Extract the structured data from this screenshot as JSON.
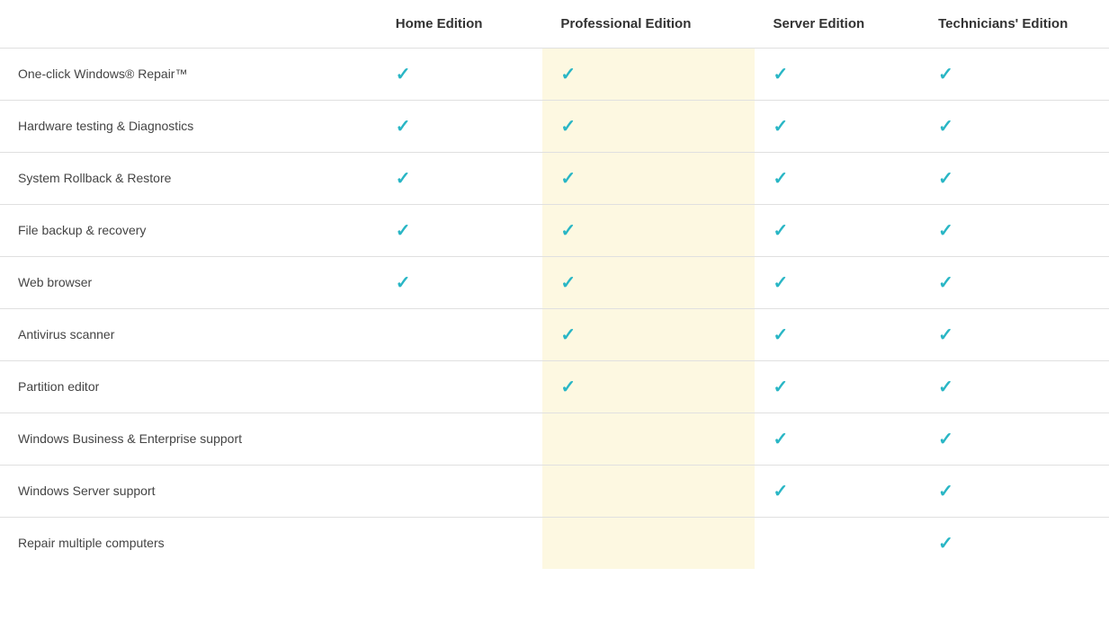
{
  "table": {
    "columns": {
      "feature": "",
      "home": "Home Edition",
      "professional": "Professional Edition",
      "server": "Server Edition",
      "technicians": "Technicians' Edition"
    },
    "rows": [
      {
        "feature": "One-click Windows® Repair™",
        "home": true,
        "professional": true,
        "server": true,
        "technicians": true
      },
      {
        "feature": "Hardware testing & Diagnostics",
        "home": true,
        "professional": true,
        "server": true,
        "technicians": true
      },
      {
        "feature": "System Rollback & Restore",
        "home": true,
        "professional": true,
        "server": true,
        "technicians": true
      },
      {
        "feature": "File backup & recovery",
        "home": true,
        "professional": true,
        "server": true,
        "technicians": true
      },
      {
        "feature": "Web browser",
        "home": true,
        "professional": true,
        "server": true,
        "technicians": true
      },
      {
        "feature": "Antivirus scanner",
        "home": false,
        "professional": true,
        "server": true,
        "technicians": true
      },
      {
        "feature": "Partition editor",
        "home": false,
        "professional": true,
        "server": true,
        "technicians": true
      },
      {
        "feature": "Windows Business & Enterprise support",
        "home": false,
        "professional": false,
        "server": true,
        "technicians": true
      },
      {
        "feature": "Windows Server support",
        "home": false,
        "professional": false,
        "server": true,
        "technicians": true
      },
      {
        "feature": "Repair multiple computers",
        "home": false,
        "professional": false,
        "server": false,
        "technicians": true
      }
    ],
    "checkmark": "✓"
  }
}
